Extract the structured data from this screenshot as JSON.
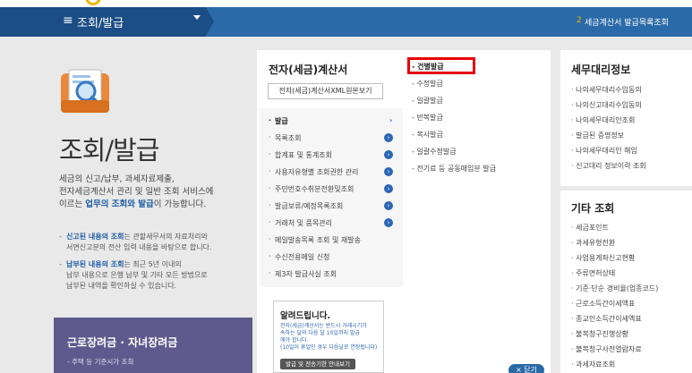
{
  "navbar": {
    "title": "조회/발급",
    "breadcrumb_num": "2",
    "breadcrumb": "세금계산서 발급목록조회"
  },
  "hero": {
    "title": "조회/발급",
    "desc_1": "세금의 신고/납부, 과세자료제출,",
    "desc_2": "전자세금계산서 관리 및 일반 조회 서비스에",
    "desc_3a": "이르는 ",
    "desc_3b": "업무의 조회와 발급",
    "desc_3c": "이 가능합니다.",
    "note1_b": "신고된 내용의 조회",
    "note1_a": "는 관할세무서의 자료처리와",
    "note1_c": "서면신고분의 전산 입력 내용을 바탕으로 합니다.",
    "note2_b": "납부된 내용의 조회",
    "note2_a": "는 최근 5년 이내의",
    "note2_c": "납부 내용으로 은행 납부 및 기타 모든 방법으로",
    "note2_d": "납부된 내역을 확인하실 수 있습니다.",
    "purple_title": "근로장려금 · 자녀장려금",
    "purple_sub": "- 주택 등 기준시가 조회"
  },
  "einvoice": {
    "title": "전자(세금)계산서",
    "xml_button": "전자(세금)계산서XML원본보기",
    "left_items": [
      "발급",
      "목록조회",
      "합계표 및 통계조회",
      "사용자유형별 조회권한 관리",
      "주민번호수취분전환및조회",
      "발급보류/예정목록조회",
      "거래처 및 품목관리",
      "메일발송목록 조회 및 재발송",
      "수신전용메일 신청",
      "제3자 발급사실 조회"
    ],
    "right_items": [
      "건별발급",
      "수정발급",
      "일괄발급",
      "반복발급",
      "복사발급",
      "일괄수정발급",
      "전기료 등 공동매입분 발급"
    ]
  },
  "notice": {
    "title": "알려드립니다.",
    "line1": "전자(세금)계산서는 반드시 거래시기가",
    "line2": "속하는 달의 다음 달 10일까지 발급",
    "line3": "해야 합니다.",
    "line4": "(10일이 휴일인 경우 다음날로 연장됩니다)",
    "button": "발급 및 전송기한 안내보기"
  },
  "close_button": "× 닫기",
  "tax_agent": {
    "title": "세무대리정보",
    "items": [
      "나의세무대리수임동의",
      "나의신고대리수임동의",
      "나의세무대리인조회",
      "발급된 증명정보",
      "나의세무대리인 해임",
      "신고대리 정보이력 조회"
    ]
  },
  "etc": {
    "title": "기타 조회",
    "items": [
      "세금포인트",
      "과세유형전환",
      "사업용계좌신고현황",
      "주류면허상태",
      "기준·단순 경비율(업종코드)",
      "근로소득간이세액표",
      "종교인소득간이세액표",
      "불복청구진행상황",
      "불복청구사전열람자료",
      "과세자료조회"
    ]
  },
  "colors": {
    "nav_blue": "#2a6aa8",
    "nav_dark": "#1b4d86",
    "accent_blue": "#1f5ea8",
    "highlight_red": "#e60000",
    "purple": "#5e5a8e"
  }
}
